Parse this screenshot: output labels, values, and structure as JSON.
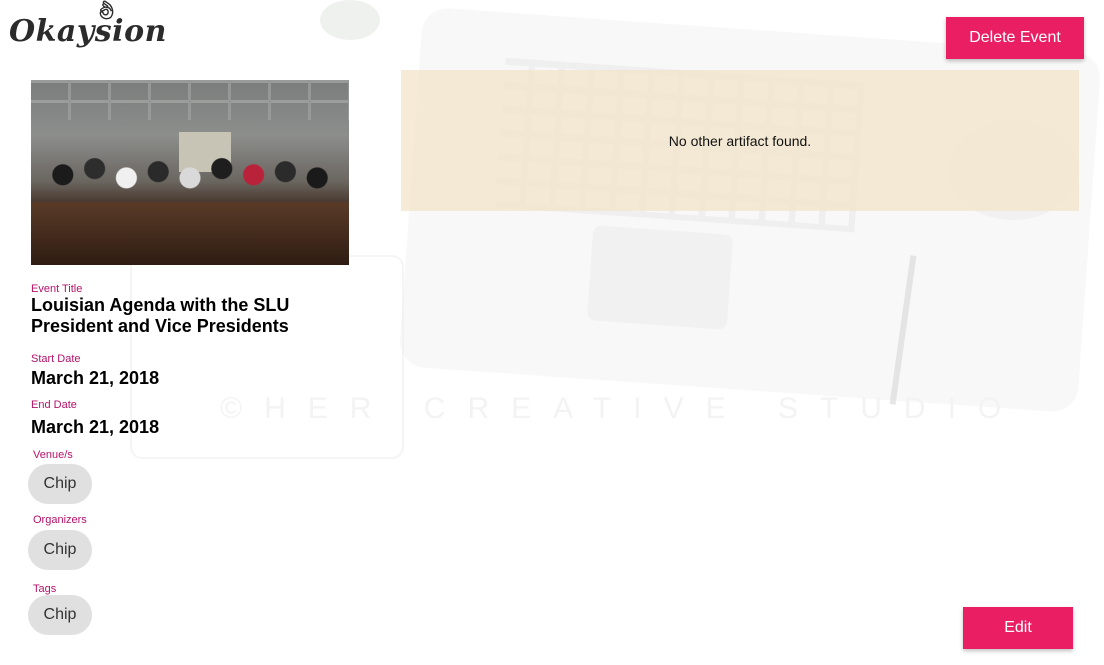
{
  "app": {
    "logo_text": "Okaysion"
  },
  "toolbar": {
    "delete_label": "Delete Event",
    "edit_label": "Edit"
  },
  "event": {
    "title_label": "Event Title",
    "title_value": "Louisian Agenda with the SLU President and Vice Presidents",
    "start_label": "Start Date",
    "start_value": "March 21, 2018",
    "end_label": "End Date",
    "end_value": "March 21, 2018",
    "venues_label": "Venue/s",
    "venues": [
      "Chip"
    ],
    "organizers_label": "Organizers",
    "organizers": [
      "Chip"
    ],
    "tags_label": "Tags",
    "tags": [
      "Chip"
    ]
  },
  "artifacts": {
    "empty_message": "No other artifact found."
  },
  "colors": {
    "accent": "#e91e63",
    "label": "#b5126a",
    "panel": "#f3e4c8",
    "chip": "#e0e0e0"
  }
}
